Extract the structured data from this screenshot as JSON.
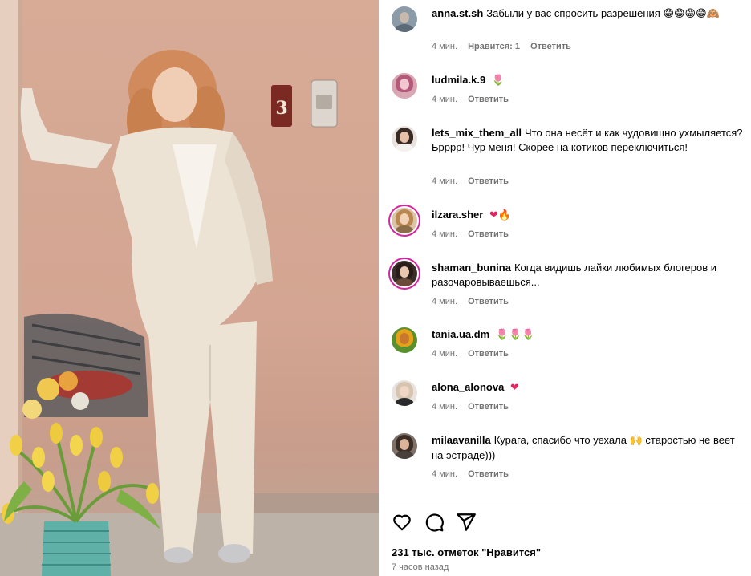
{
  "photo": {
    "door_number": "3"
  },
  "comments": [
    {
      "username": "anna.st.sh",
      "text": "Забыли у вас спросить разрешения",
      "emoji": "😁😁😁😁🙈",
      "time": "4 мин.",
      "likes": "Нравится: 1",
      "reply": "Ответить"
    },
    {
      "username": "ludmila.k.9",
      "text": "",
      "emoji": "🌷",
      "time": "4 мин.",
      "reply": "Ответить"
    },
    {
      "username": "lets_mix_them_all",
      "text": "Что она несёт и как чудовищно ухмыляется? Брррр! Чур меня! Скорее на котиков переключиться!",
      "emoji": "",
      "time": "4 мин.",
      "reply": "Ответить"
    },
    {
      "username": "ilzara.sher",
      "text": "",
      "emoji": "❤🔥",
      "time": "4 мин.",
      "reply": "Ответить"
    },
    {
      "username": "shaman_bunina",
      "text": "Когда видишь лайки любимых блогеров и разочаровываешься...",
      "emoji": "",
      "time": "4 мин.",
      "reply": "Ответить"
    },
    {
      "username": "tania.ua.dm",
      "text": "",
      "emoji": "🌷🌷🌷",
      "time": "4 мин.",
      "reply": "Ответить"
    },
    {
      "username": "alona_alonova",
      "text": "",
      "emoji": "❤",
      "time": "4 мин.",
      "reply": "Ответить"
    },
    {
      "username": "milaavanilla",
      "text_before": "Курага, спасибо что уехала",
      "emoji": "🙌",
      "text_after": "старостью не веет на эстраде)))",
      "time": "4 мин.",
      "reply": "Ответить"
    }
  ],
  "actions": {
    "like_icon": "heart-icon",
    "comment_icon": "comment-icon",
    "share_icon": "share-icon"
  },
  "likes_count": "231 тыс. отметок \"Нравится\"",
  "posted_ago": "7 часов назад",
  "colors": {
    "meta_gray": "#737373",
    "story_ring": "#d6249f",
    "heart_red": "#e0245e"
  }
}
